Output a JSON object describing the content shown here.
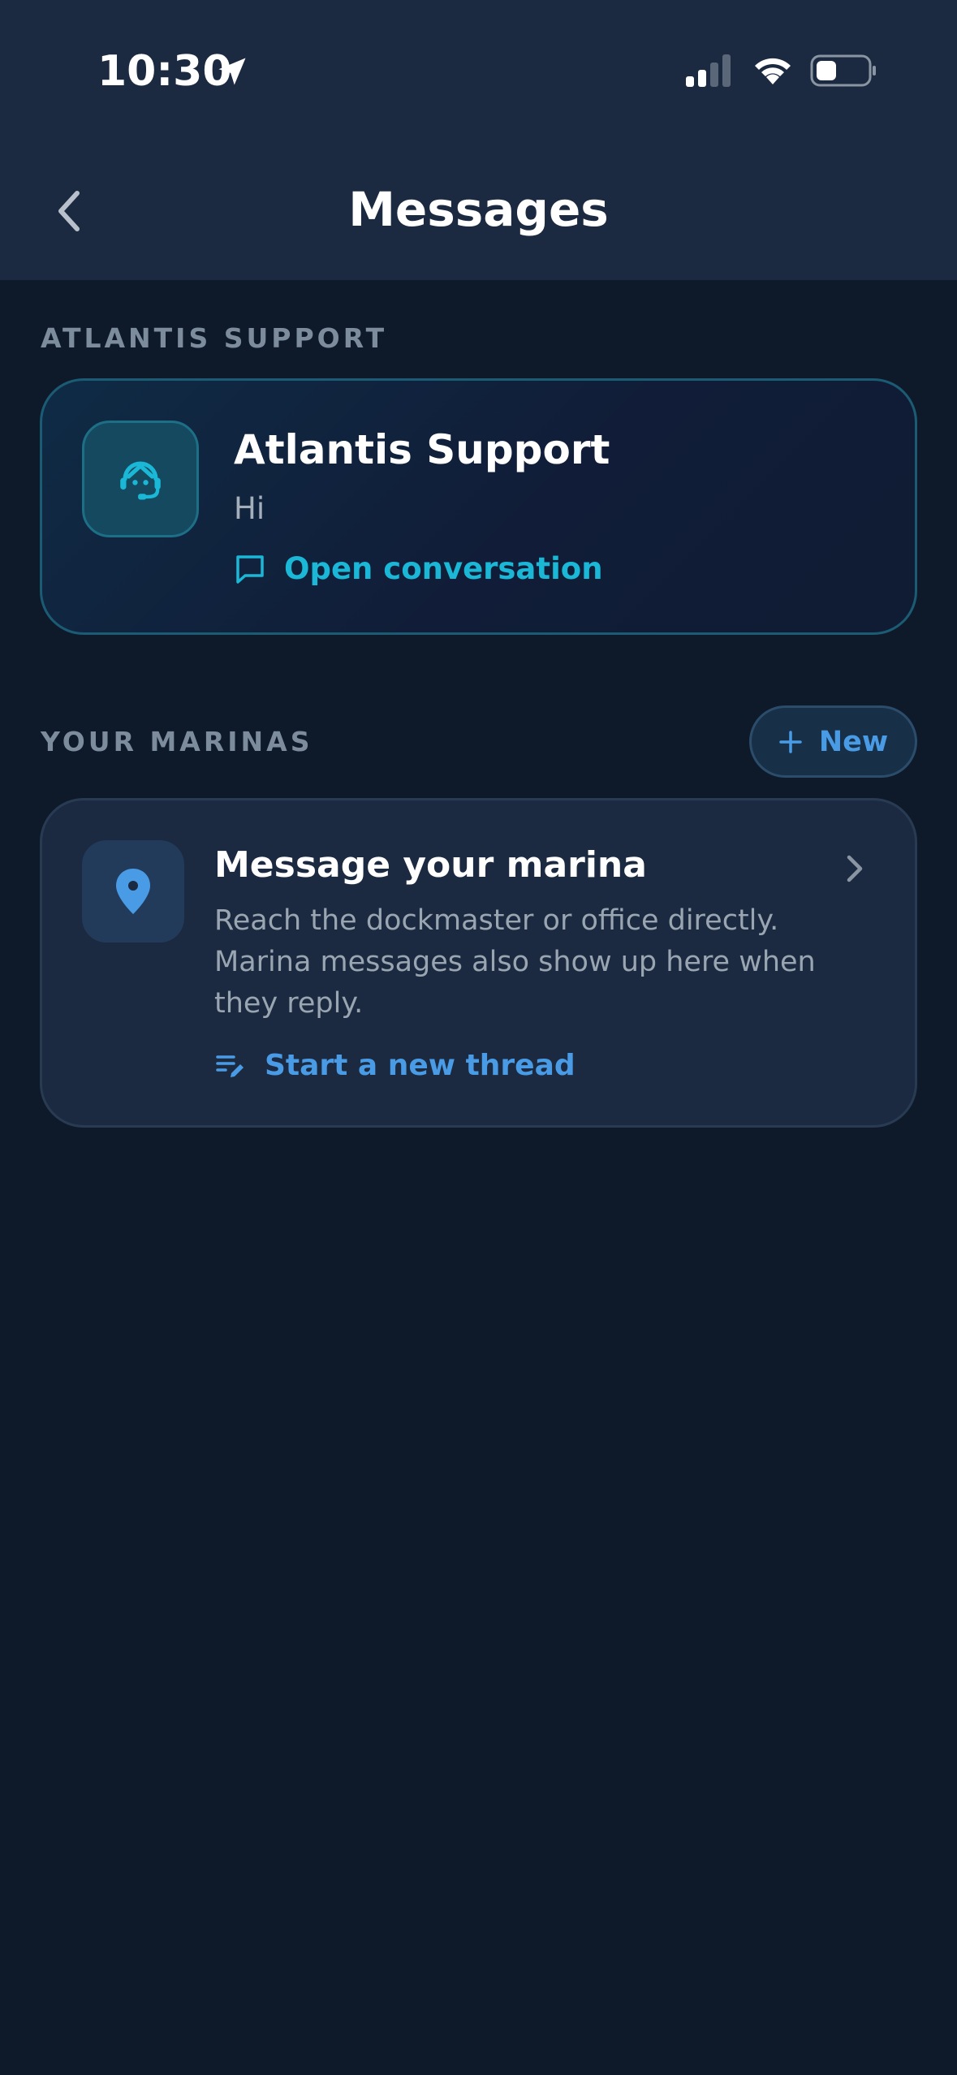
{
  "status_bar": {
    "time": "10:30",
    "icons": [
      "location-arrow-icon",
      "cellular-signal-icon",
      "wifi-icon",
      "battery-icon"
    ]
  },
  "nav": {
    "title": "Messages",
    "back_icon": "chevron-left-icon"
  },
  "support_section": {
    "label": "ATLANTIS SUPPORT",
    "card": {
      "icon": "support-agent-icon",
      "name": "Atlantis Support",
      "preview": "Hi",
      "link_icon": "chat-bubble-icon",
      "link_label": "Open conversation"
    }
  },
  "marinas_section": {
    "label": "YOUR MARINAS",
    "new_button": {
      "icon": "plus-icon",
      "label": "New"
    },
    "card": {
      "icon": "location-pin-icon",
      "title": "Message your marina",
      "description": "Reach the dockmaster or office directly. Marina messages also show up here when they reply.",
      "chevron_icon": "chevron-right-icon",
      "link_icon": "compose-list-icon",
      "link_label": "Start a new thread"
    }
  },
  "colors": {
    "background": "#0e1a2a",
    "header": "#1b2a40",
    "support_accent": "#1ab8d6",
    "marina_accent": "#4a9be5",
    "muted_text": "#7d8c9c"
  }
}
